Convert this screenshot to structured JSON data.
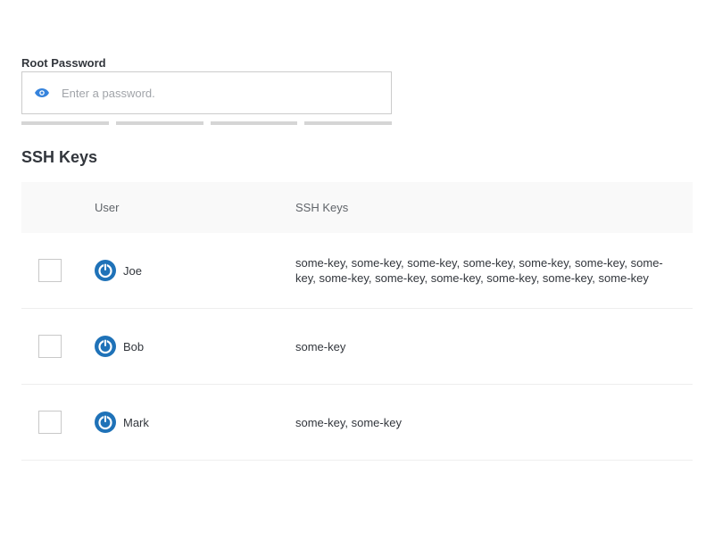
{
  "password": {
    "label": "Root Password",
    "placeholder": "Enter a password.",
    "value": "",
    "toggle_icon": "eye-icon",
    "strength_segments": 4,
    "strength_filled": 0
  },
  "ssh_keys": {
    "title": "SSH Keys",
    "columns": [
      "User",
      "SSH Keys"
    ],
    "rows": [
      {
        "user": "Joe",
        "keys": "some-key, some-key, some-key, some-key, some-key, some-key, some-key, some-key, some-key, some-key, some-key, some-key, some-key",
        "checked": false
      },
      {
        "user": "Bob",
        "keys": "some-key",
        "checked": false
      },
      {
        "user": "Mark",
        "keys": "some-key, some-key",
        "checked": false
      }
    ]
  },
  "colors": {
    "accent": "#1f72b8",
    "eye_icon": "#3683dc",
    "header_bg": "#f9f9f9",
    "strength_empty": "#d5d5d5"
  }
}
